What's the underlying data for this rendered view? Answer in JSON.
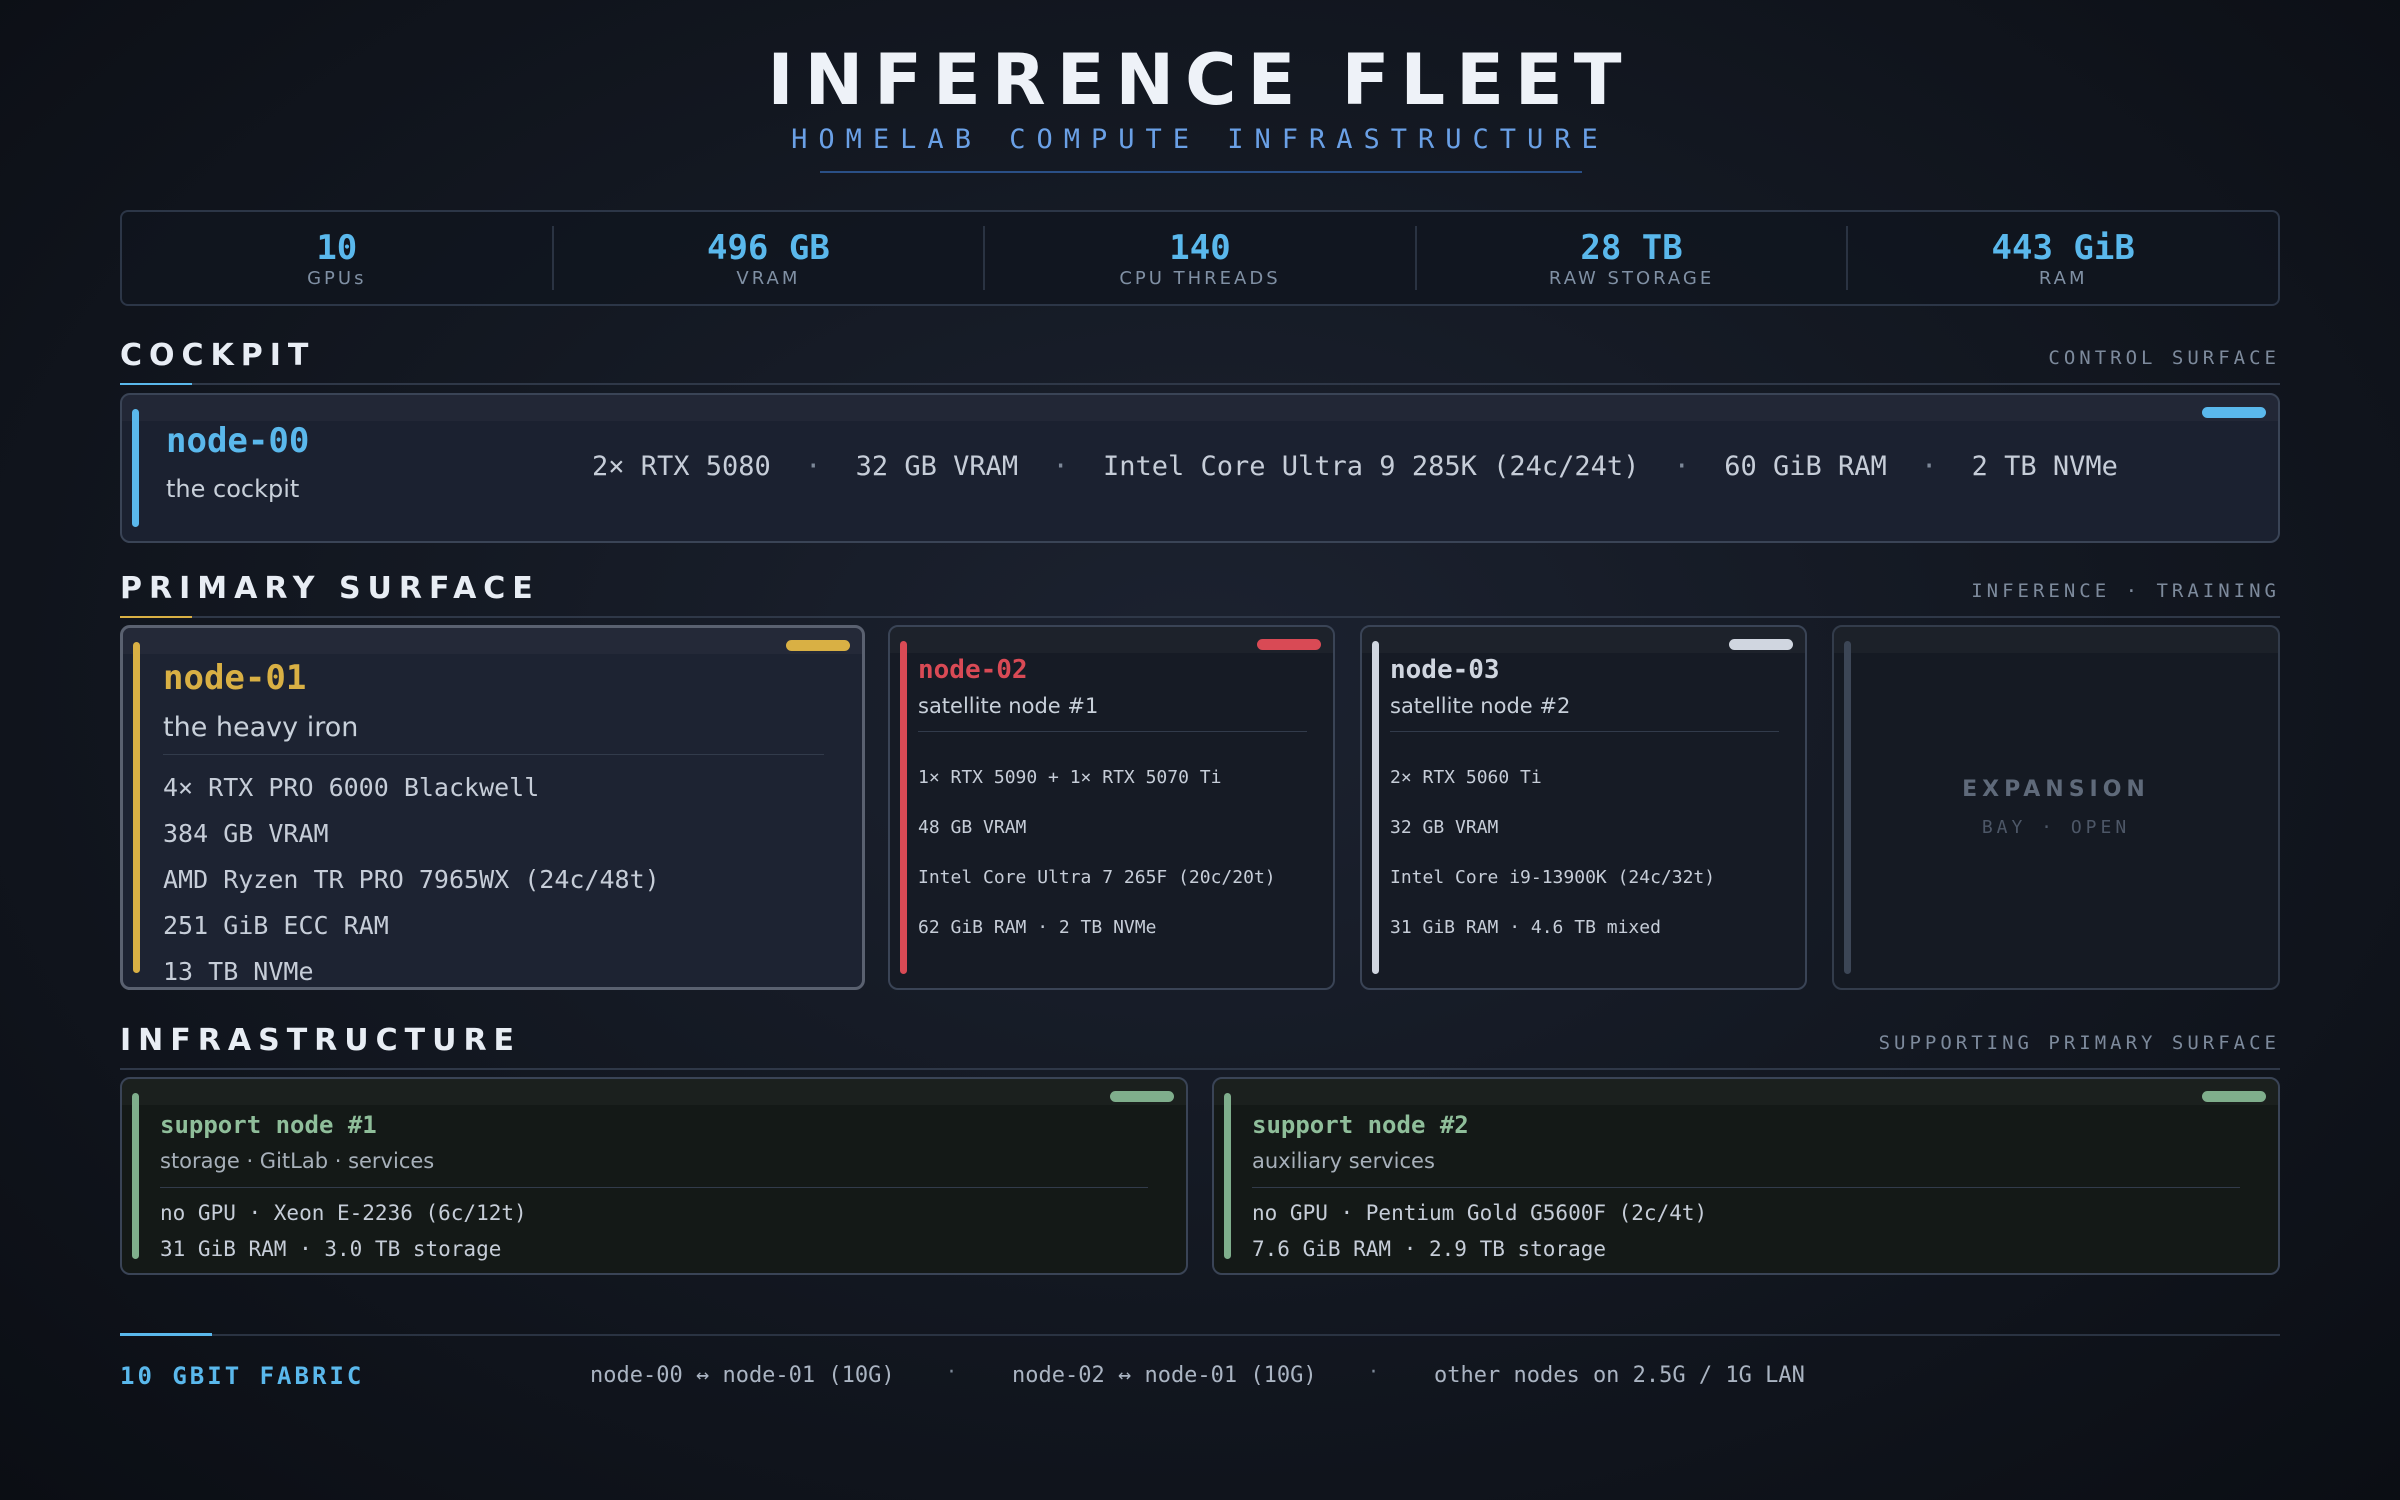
{
  "header": {
    "title": "INFERENCE FLEET",
    "subtitle": "HOMELAB COMPUTE INFRASTRUCTURE"
  },
  "stats": [
    {
      "value": "10",
      "label": "GPUs"
    },
    {
      "value": "496 GB",
      "label": "VRAM"
    },
    {
      "value": "140",
      "label": "CPU THREADS"
    },
    {
      "value": "28 TB",
      "label": "RAW STORAGE"
    },
    {
      "value": "443 GiB",
      "label": "RAM"
    }
  ],
  "sections": {
    "cockpit": {
      "title": "COCKPIT",
      "right": "CONTROL SURFACE"
    },
    "primary": {
      "title": "PRIMARY SURFACE",
      "right": "INFERENCE · TRAINING"
    },
    "infra": {
      "title": "INFRASTRUCTURE",
      "right": "SUPPORTING PRIMARY SURFACE"
    }
  },
  "cockpit": {
    "name": "node-00",
    "role": "the cockpit",
    "specs": [
      "2× RTX 5080",
      "32 GB VRAM",
      "Intel Core Ultra 9 285K (24c/24t)",
      "60 GiB RAM",
      "2 TB NVMe"
    ],
    "separator": "·"
  },
  "primary": {
    "node01": {
      "name": "node-01",
      "role": "the heavy iron",
      "specs": [
        "4× RTX PRO 6000 Blackwell",
        "384 GB VRAM",
        "AMD Ryzen TR PRO 7965WX (24c/48t)",
        "251 GiB ECC RAM",
        "13 TB NVMe"
      ]
    },
    "node02": {
      "name": "node-02",
      "role": "satellite node #1",
      "specs": [
        "1× RTX 5090 + 1× RTX 5070 Ti",
        "48 GB VRAM",
        "Intel Core Ultra 7 265F (20c/20t)",
        "62 GiB RAM  ·  2 TB NVMe"
      ]
    },
    "node03": {
      "name": "node-03",
      "role": "satellite node #2",
      "specs": [
        "2× RTX 5060 Ti",
        "32 GB VRAM",
        "Intel Core i9-13900K (24c/32t)",
        "31 GiB RAM  ·  4.6 TB mixed"
      ]
    },
    "expansion": {
      "title": "EXPANSION",
      "sub": "BAY · OPEN"
    }
  },
  "infra": {
    "support1": {
      "name": "support node #1",
      "role": "storage · GitLab · services",
      "specs": [
        "no GPU  ·  Xeon E-2236 (6c/12t)",
        "31 GiB RAM  ·  3.0 TB storage"
      ]
    },
    "support2": {
      "name": "support node #2",
      "role": "auxiliary services",
      "specs": [
        "no GPU  ·  Pentium Gold G5600F (2c/4t)",
        "7.6 GiB RAM  ·  2.9 TB storage"
      ]
    }
  },
  "footer": {
    "title": "10 GBIT FABRIC",
    "links": [
      "node-00 ↔ node-01 (10G)",
      "node-02 ↔ node-01 (10G)",
      "other nodes on 2.5G / 1G LAN"
    ],
    "separator": "·"
  },
  "colors": {
    "accent_blue": "#5ab8ec",
    "node01_gold": "#d9b044",
    "node02_red": "#d94a55",
    "node03_white": "#d0d6e0",
    "support_green": "#7fae8c",
    "expansion_gray": "#3c4656"
  }
}
